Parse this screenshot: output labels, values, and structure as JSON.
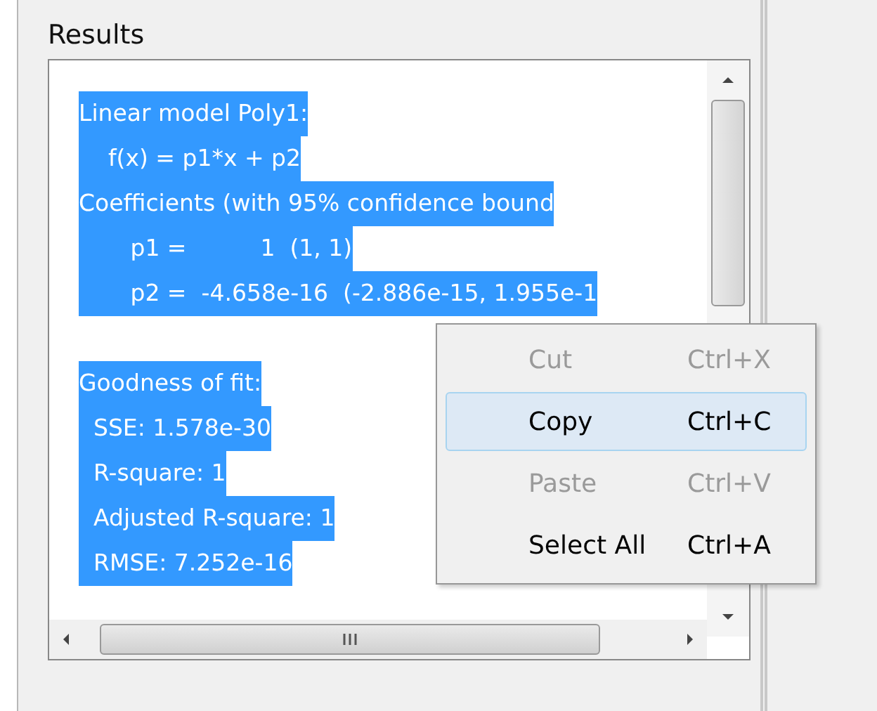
{
  "panel": {
    "title": "Results"
  },
  "results": {
    "selected": true,
    "sections": [
      {
        "lines": [
          "Linear model Poly1:",
          "    f(x) = p1*x + p2",
          "Coefficients (with 95% confidence bound",
          "       p1 =          1  (1, 1)",
          "       p2 =  -4.658e-16  (-2.886e-15, 1.955e-1"
        ]
      },
      {
        "lines": [
          "Goodness of fit:",
          "  SSE: 1.578e-30",
          "  R-square: 1",
          "  Adjusted R-square: 1",
          "  RMSE: 7.252e-16"
        ]
      }
    ]
  },
  "context_menu": {
    "items": [
      {
        "label": "Cut",
        "shortcut": "Ctrl+X",
        "disabled": true,
        "selected": false
      },
      {
        "label": "Copy",
        "shortcut": "Ctrl+C",
        "disabled": false,
        "selected": true
      },
      {
        "label": "Paste",
        "shortcut": "Ctrl+V",
        "disabled": true,
        "selected": false
      },
      {
        "label": "Select All",
        "shortcut": "Ctrl+A",
        "disabled": false,
        "selected": false
      }
    ]
  }
}
